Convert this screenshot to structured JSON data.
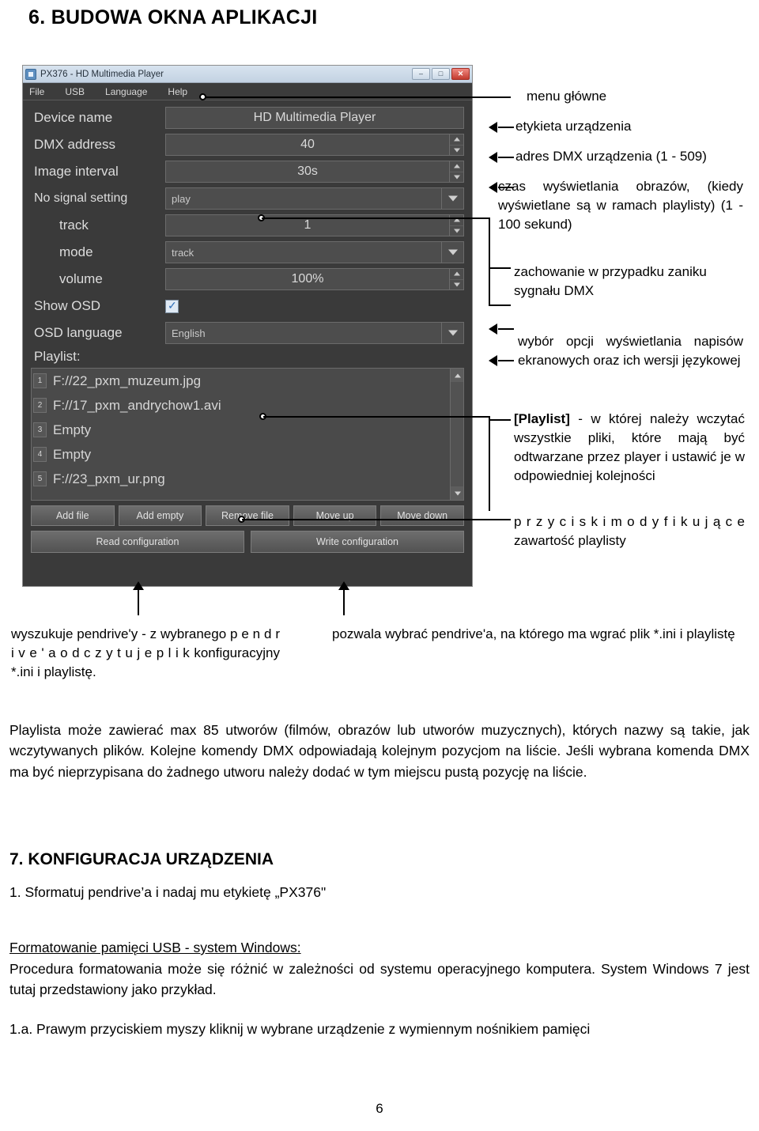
{
  "heading": "6. BUDOWA OKNA APLIKACJI",
  "app": {
    "titlebar": {
      "title": "PX376 - HD Multimedia Player",
      "minimize": "–",
      "maximize": "□",
      "close": "✕"
    },
    "menu": [
      "File",
      "USB",
      "Language",
      "Help"
    ],
    "fields": {
      "device_name": {
        "label": "Device name",
        "value": "HD Multimedia Player"
      },
      "dmx_address": {
        "label": "DMX address",
        "value": "40"
      },
      "image_interval": {
        "label": "Image interval",
        "value": "30s"
      },
      "no_signal_setting": {
        "label": "No signal setting",
        "value": "play"
      },
      "track": {
        "label": "track",
        "value": "1"
      },
      "mode": {
        "label": "mode",
        "value": "track"
      },
      "volume": {
        "label": "volume",
        "value": "100%"
      },
      "show_osd": {
        "label": "Show OSD",
        "checked": true
      },
      "osd_language": {
        "label": "OSD language",
        "value": "English"
      },
      "playlist_label": "Playlist:"
    },
    "playlist": [
      {
        "num": "1",
        "name": "F://22_pxm_muzeum.jpg"
      },
      {
        "num": "2",
        "name": "F://17_pxm_andrychow1.avi"
      },
      {
        "num": "3",
        "name": "Empty"
      },
      {
        "num": "4",
        "name": "Empty"
      },
      {
        "num": "5",
        "name": "F://23_pxm_ur.png"
      }
    ],
    "buttons": {
      "add_file": "Add file",
      "add_empty": "Add empty",
      "remove_file": "Remove file",
      "move_up": "Move up",
      "move_down": "Move down",
      "read_configuration": "Read configuration",
      "write_configuration": "Write configuration"
    }
  },
  "callouts": {
    "menu_glowne": "menu główne",
    "etykieta": "etykieta urządzenia",
    "dmx": "adres DMX urządzenia (1 - 509)",
    "czas": "czas  wyświetlania  obrazów, (kiedy wyświetlane są w ramach playlisty) (1 - 100 sekund)",
    "zachowanie": "zachowanie w przypadku zaniku sygnału DMX",
    "wybor": "wybór  opcji  wyświetlania napisów ekranowych oraz ich wersji językowej",
    "playlist_bold": "[Playlist]",
    "playlist_rest": " - w której należy wczytać wszystkie pliki, które mają być odtwarzane przez player i ustawić je w odpowiedniej kolejności",
    "przyciski": "p r z y c i s k i   m o d y f i k u j ą c e zawartość playlisty",
    "wyszukuje": "wyszukuje pendrive'y - z wybranego p e n d r i v e ' a   o d c z y t u j e   p l i k konfiguracyjny *.ini i playlistę.",
    "pozwala": "pozwala wybrać pendrive'a, na którego ma wgrać plik *.ini i playlistę"
  },
  "body": {
    "p1": "Playlista może zawierać max 85 utworów (filmów, obrazów lub utworów muzycznych), których nazwy są takie, jak wczytywanych plików. Kolejne komendy DMX odpowiadają kolejnym pozycjom na liście. Jeśli wybrana komenda DMX ma być nieprzypisana do żadnego utworu należy dodać w tym miejscu pustą pozycję na liście.",
    "h7": "7. KONFIGURACJA URZĄDZENIA",
    "p2": "1. Sformatuj pendrive’a i nadaj mu etykietę „PX376\"",
    "p3_underline": "Formatowanie pamięci USB - system Windows:",
    "p4": "Procedura formatowania może się różnić w zależności od systemu operacyjnego komputera. System Windows 7 jest tutaj przedstawiony jako przykład.",
    "p5": "1.a. Prawym przyciskiem myszy kliknij w wybrane urządzenie z wymiennym nośnikiem pamięci"
  },
  "page_number": "6"
}
